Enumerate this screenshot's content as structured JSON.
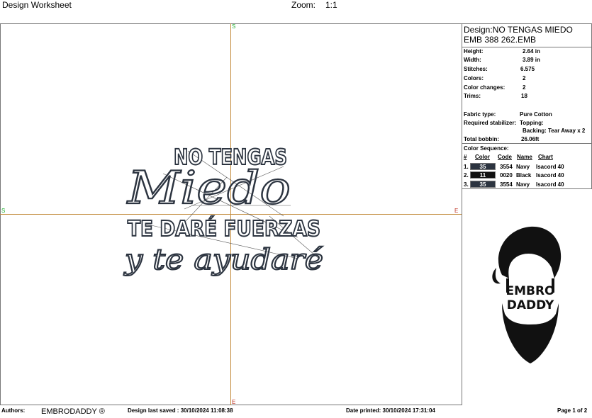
{
  "header": {
    "title": "Design Worksheet",
    "zoom_label": "Zoom:",
    "zoom_value": "1:1"
  },
  "design": {
    "line1": "NO TENGAS",
    "line2": "Miedo",
    "line3": "TE DARÉ FUERZAS",
    "line4": "y te ayudaré",
    "thread_color": "#2c3440"
  },
  "markers": {
    "start": "S",
    "end": "E",
    "start_color": "#1fae2f",
    "end_color": "#c0392b"
  },
  "info": {
    "design_line": "Design:NO TENGAS MIEDO",
    "file_line": "EMB 388 262.EMB",
    "rows": [
      {
        "label": "Height:",
        "value": "2.64 in"
      },
      {
        "label": "Width:",
        "value": "3.89 in"
      },
      {
        "label": "Stitches:",
        "value": "6.575"
      },
      {
        "label": "Colors:",
        "value": "2"
      },
      {
        "label": "Color changes:",
        "value": "2"
      },
      {
        "label": "Trims:",
        "value": "18"
      }
    ],
    "fabric_label": "Fabric type:",
    "fabric_value": "Pure Cotton",
    "stabilizer_label": "Required stabilizer:",
    "topping_value": "Topping:",
    "backing_value": "Backing: Tear Away x 2",
    "bobbin_label": "Total bobbin:",
    "bobbin_value": "26.06ft"
  },
  "color_sequence": {
    "title": "Color Sequence:",
    "headers": [
      "#",
      "Color",
      "Code",
      "Name",
      "Chart"
    ],
    "rows": [
      {
        "index": "1.",
        "color_no": "35",
        "code": "3554",
        "name": "Navy",
        "chart": "Isacord 40",
        "hex": "#2c3440"
      },
      {
        "index": "2.",
        "color_no": "11",
        "code": "0020",
        "name": "Black",
        "chart": "Isacord 40",
        "hex": "#111111"
      },
      {
        "index": "3.",
        "color_no": "35",
        "code": "3554",
        "name": "Navy",
        "chart": "Isacord 40",
        "hex": "#2c3440"
      }
    ]
  },
  "logo": {
    "line1": "EMBRO",
    "line2": "DADDY"
  },
  "footer": {
    "authors_label": "Authors:",
    "company": "EMBRODADDY ®",
    "last_saved": "Design last saved : 30/10/2024 11:08:38",
    "printed": "Date printed: 30/10/2024 17:31:04",
    "page": "Page 1 of 2"
  }
}
